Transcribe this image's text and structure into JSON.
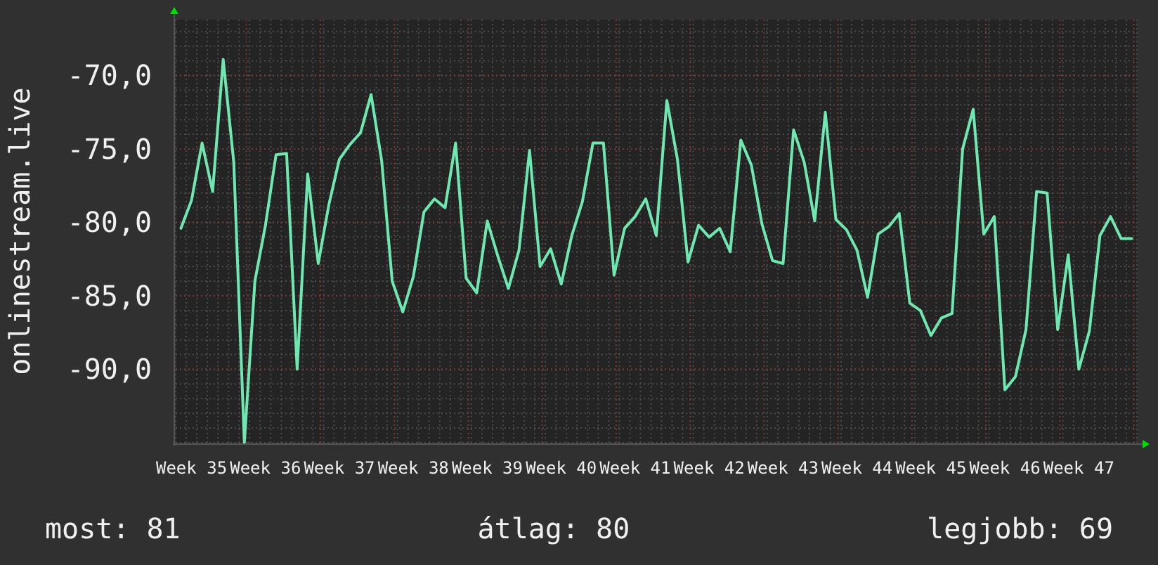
{
  "chart_data": {
    "type": "line",
    "ylabel": "onlinestream.live",
    "grid": true,
    "categories": [
      null,
      "Week 35",
      null,
      null,
      null,
      null,
      null,
      null,
      "Week 36",
      null,
      null,
      null,
      null,
      null,
      null,
      "Week 37",
      null,
      null,
      null,
      null,
      null,
      null,
      "Week 38",
      null,
      null,
      null,
      null,
      null,
      null,
      "Week 39",
      null,
      null,
      null,
      null,
      null,
      null,
      "Week 40",
      null,
      null,
      null,
      null,
      null,
      null,
      "Week 41",
      null,
      null,
      null,
      null,
      null,
      null,
      "Week 42",
      null,
      null,
      null,
      null,
      null,
      null,
      "Week 43",
      null,
      null,
      null,
      null,
      null,
      null,
      "Week 44",
      null,
      null,
      null,
      null,
      null,
      null,
      "Week 45",
      null,
      null,
      null,
      null,
      null,
      null,
      "Week 46",
      null,
      null,
      null,
      null,
      null,
      null,
      "Week 47",
      null,
      null,
      null,
      null,
      null
    ],
    "values": [
      -80.4,
      -78.5,
      -74.6,
      -77.9,
      -68.9,
      -75.9,
      -95,
      -84.0,
      -80.2,
      -75.4,
      -75.3,
      -90.0,
      -76.7,
      -82.8,
      -78.8,
      -75.7,
      -74.7,
      -73.9,
      -71.3,
      -75.8,
      -84.0,
      -86.1,
      -83.7,
      -79.3,
      -78.4,
      -79.0,
      -74.6,
      -83.8,
      -84.8,
      -79.9,
      -82.3,
      -84.5,
      -81.9,
      -75.1,
      -83.0,
      -81.8,
      -84.2,
      -80.9,
      -78.6,
      -74.6,
      -74.6,
      -83.6,
      -80.4,
      -79.6,
      -78.4,
      -80.9,
      -71.7,
      -75.7,
      -82.7,
      -80.2,
      -81.0,
      -80.4,
      -82.0,
      -74.4,
      -76.1,
      -80.1,
      -82.6,
      -82.8,
      -73.7,
      -75.9,
      -79.9,
      -72.5,
      -79.8,
      -80.5,
      -81.9,
      -85.1,
      -80.8,
      -80.3,
      -79.4,
      -85.5,
      -86.0,
      -87.7,
      -86.5,
      -86.2,
      -75.0,
      -72.3,
      -80.8,
      -79.6,
      -91.4,
      -90.5,
      -87.3,
      -77.9,
      -78.0,
      -87.3,
      -82.2,
      -90.0,
      -87.4,
      -80.9,
      -79.6,
      -81.1,
      -81.1
    ],
    "ylim": [
      -95,
      -66.2
    ],
    "yticks": [
      {
        "value": -70,
        "label": "-70,0"
      },
      {
        "value": -75,
        "label": "-75,0"
      },
      {
        "value": -80,
        "label": "-80,0"
      },
      {
        "value": -85,
        "label": "-85,0"
      },
      {
        "value": -90,
        "label": "-90,0"
      }
    ]
  },
  "stats": [
    "most: 81",
    "átlag: 80",
    "legjobb: 69"
  ]
}
